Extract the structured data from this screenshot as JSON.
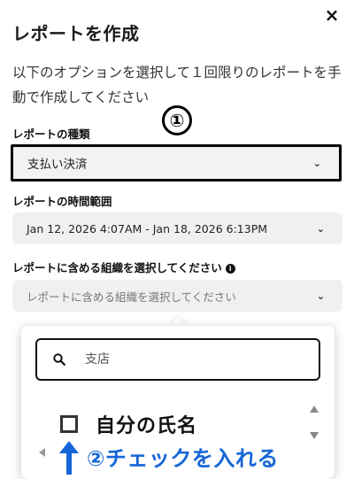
{
  "dialog": {
    "title": "レポートを作成",
    "close_glyph": "×",
    "description": "以下のオプションを選択して１回限りのレポートを手動で作成してください"
  },
  "fields": {
    "type": {
      "label": "レポートの種類",
      "value": "支払い決済"
    },
    "period": {
      "label": "レポートの時間範囲",
      "value": "Jan 12, 2026 4:07AM - Jan 18, 2026 6:13PM"
    },
    "org": {
      "label": "レポートに含める組織を選択してください",
      "placeholder": "レポートに含める組織を選択してください",
      "info_glyph": "i"
    }
  },
  "dropdown": {
    "search_placeholder": "支店",
    "option_label": "自分の氏名",
    "option_checked": false
  },
  "annotations": {
    "marker_1": "①",
    "instruction": "②チェックを入れる",
    "instruction_color": "#1565d8"
  }
}
